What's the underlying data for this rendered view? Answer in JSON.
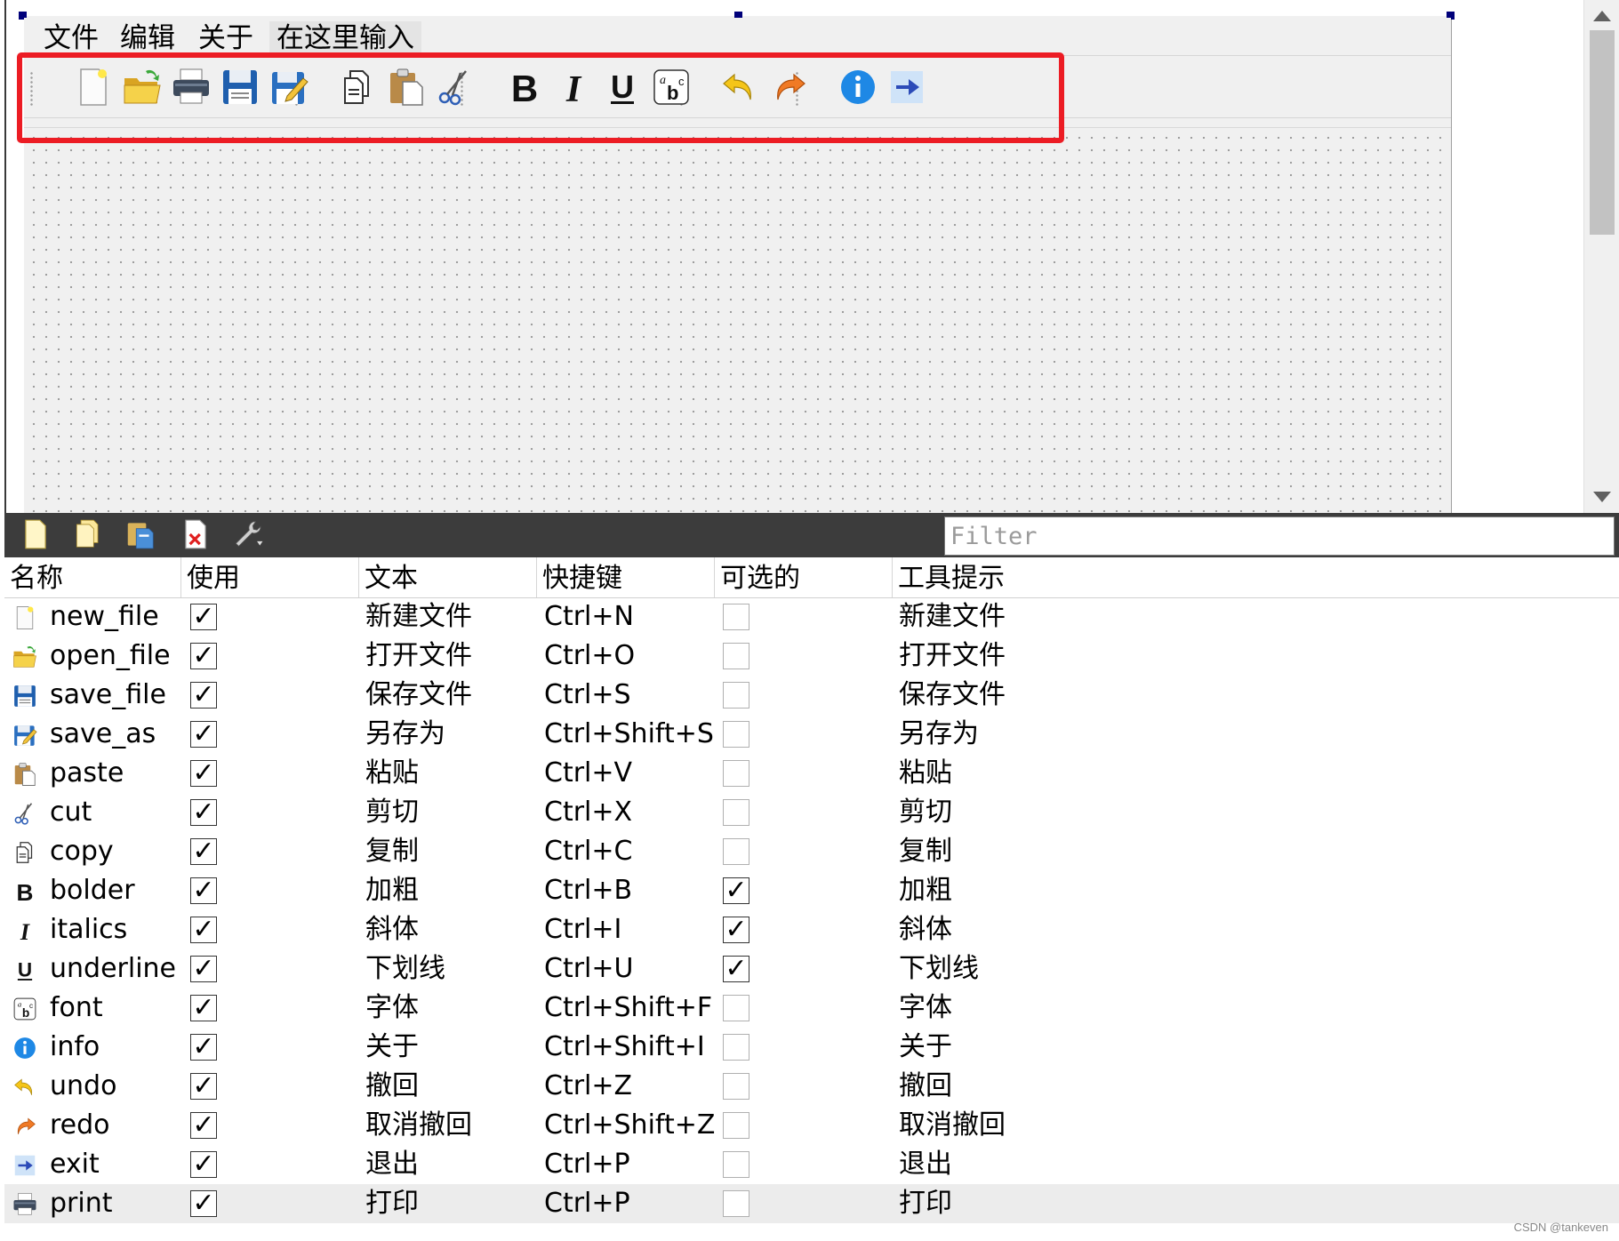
{
  "designer": {
    "menu": [
      "文件",
      "编辑",
      "关于"
    ],
    "menu_placeholder": "在这里输入",
    "toolbar_actions": [
      {
        "name": "new_file",
        "icon": "new-file-icon"
      },
      {
        "name": "open_file",
        "icon": "open-folder-icon"
      },
      {
        "name": "print",
        "icon": "printer-icon"
      },
      {
        "name": "save_file",
        "icon": "save-disk-icon"
      },
      {
        "name": "save_as",
        "icon": "save-as-icon"
      },
      {
        "name": "copy",
        "icon": "copy-icon"
      },
      {
        "name": "paste",
        "icon": "paste-icon"
      },
      {
        "name": "cut",
        "icon": "scissors-icon"
      },
      {
        "name": "bolder",
        "icon": "bold-icon"
      },
      {
        "name": "italics",
        "icon": "italic-icon"
      },
      {
        "name": "underline",
        "icon": "underline-icon"
      },
      {
        "name": "font",
        "icon": "font-icon"
      },
      {
        "name": "undo",
        "icon": "undo-arrow-icon"
      },
      {
        "name": "redo",
        "icon": "redo-arrow-icon"
      },
      {
        "name": "info",
        "icon": "info-icon"
      },
      {
        "name": "exit",
        "icon": "exit-arrow-icon"
      }
    ],
    "highlight_color": "#ec1c24"
  },
  "action_editor": {
    "tool_icons": [
      "new-action-icon",
      "copy-action-icon",
      "paste-action-icon",
      "delete-action-icon",
      "configure-wrench-icon"
    ],
    "filter_placeholder": "Filter",
    "headers": [
      "名称",
      "使用",
      "文本",
      "快捷键",
      "可选的",
      "工具提示"
    ],
    "rows": [
      {
        "icon": "new-file-icon",
        "name": "new_file",
        "used": true,
        "text": "新建文件",
        "shortcut": "Ctrl+N",
        "checkable": false,
        "tooltip": "新建文件"
      },
      {
        "icon": "open-folder-icon",
        "name": "open_file",
        "used": true,
        "text": "打开文件",
        "shortcut": "Ctrl+O",
        "checkable": false,
        "tooltip": "打开文件"
      },
      {
        "icon": "save-disk-icon",
        "name": "save_file",
        "used": true,
        "text": "保存文件",
        "shortcut": "Ctrl+S",
        "checkable": false,
        "tooltip": "保存文件"
      },
      {
        "icon": "save-as-icon",
        "name": "save_as",
        "used": true,
        "text": "另存为",
        "shortcut": "Ctrl+Shift+S",
        "checkable": false,
        "tooltip": "另存为"
      },
      {
        "icon": "paste-icon",
        "name": "paste",
        "used": true,
        "text": "粘贴",
        "shortcut": "Ctrl+V",
        "checkable": false,
        "tooltip": "粘贴"
      },
      {
        "icon": "scissors-icon",
        "name": "cut",
        "used": true,
        "text": "剪切",
        "shortcut": "Ctrl+X",
        "checkable": false,
        "tooltip": "剪切"
      },
      {
        "icon": "copy-icon",
        "name": "copy",
        "used": true,
        "text": "复制",
        "shortcut": "Ctrl+C",
        "checkable": false,
        "tooltip": "复制"
      },
      {
        "icon": "bold-icon",
        "name": "bolder",
        "used": true,
        "text": "加粗",
        "shortcut": "Ctrl+B",
        "checkable": true,
        "tooltip": "加粗"
      },
      {
        "icon": "italic-icon",
        "name": "italics",
        "used": true,
        "text": "斜体",
        "shortcut": "Ctrl+I",
        "checkable": true,
        "tooltip": "斜体"
      },
      {
        "icon": "underline-icon",
        "name": "underline",
        "used": true,
        "text": "下划线",
        "shortcut": "Ctrl+U",
        "checkable": true,
        "tooltip": "下划线"
      },
      {
        "icon": "font-icon",
        "name": "font",
        "used": true,
        "text": "字体",
        "shortcut": "Ctrl+Shift+F",
        "checkable": false,
        "tooltip": "字体"
      },
      {
        "icon": "info-icon",
        "name": "info",
        "used": true,
        "text": "关于",
        "shortcut": "Ctrl+Shift+I",
        "checkable": false,
        "tooltip": "关于"
      },
      {
        "icon": "undo-arrow-icon",
        "name": "undo",
        "used": true,
        "text": "撤回",
        "shortcut": "Ctrl+Z",
        "checkable": false,
        "tooltip": "撤回"
      },
      {
        "icon": "redo-arrow-icon",
        "name": "redo",
        "used": true,
        "text": "取消撤回",
        "shortcut": "Ctrl+Shift+Z",
        "checkable": false,
        "tooltip": "取消撤回"
      },
      {
        "icon": "exit-arrow-icon",
        "name": "exit",
        "used": true,
        "text": "退出",
        "shortcut": "Ctrl+P",
        "checkable": false,
        "tooltip": "退出"
      },
      {
        "icon": "printer-icon",
        "name": "print",
        "used": true,
        "text": "打印",
        "shortcut": "Ctrl+P",
        "checkable": false,
        "tooltip": "打印",
        "selected": true
      }
    ],
    "check_mark": "✓"
  },
  "watermark": "CSDN @tankeven"
}
